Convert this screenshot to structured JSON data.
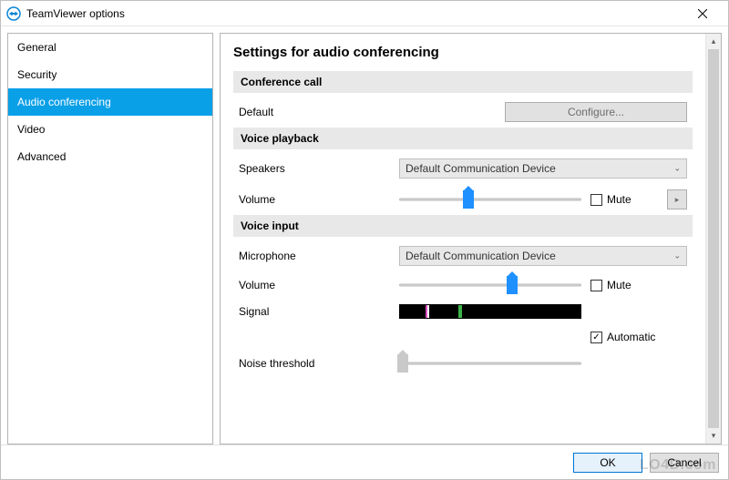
{
  "window": {
    "title": "TeamViewer options"
  },
  "sidebar": {
    "items": [
      {
        "label": "General"
      },
      {
        "label": "Security"
      },
      {
        "label": "Audio conferencing"
      },
      {
        "label": "Video"
      },
      {
        "label": "Advanced"
      }
    ],
    "selectedIndex": 2
  },
  "page": {
    "title": "Settings for audio conferencing"
  },
  "sections": {
    "conference": {
      "header": "Conference call",
      "default_label": "Default",
      "configure_label": "Configure..."
    },
    "playback": {
      "header": "Voice playback",
      "speakers_label": "Speakers",
      "speakers_value": "Default Communication Device",
      "volume_label": "Volume",
      "volume_pct": 38,
      "mute_label": "Mute",
      "mute_checked": false,
      "test_icon": "▸"
    },
    "input": {
      "header": "Voice input",
      "mic_label": "Microphone",
      "mic_value": "Default Communication Device",
      "volume_label": "Volume",
      "volume_pct": 62,
      "mute_label": "Mute",
      "mute_checked": false,
      "signal_label": "Signal",
      "noise_label": "Noise threshold",
      "noise_pct": 2,
      "auto_label": "Automatic",
      "auto_checked": true
    }
  },
  "footer": {
    "ok": "OK",
    "cancel": "Cancel"
  },
  "watermark": "LO4D.com",
  "colors": {
    "accent": "#0aa0e8"
  }
}
